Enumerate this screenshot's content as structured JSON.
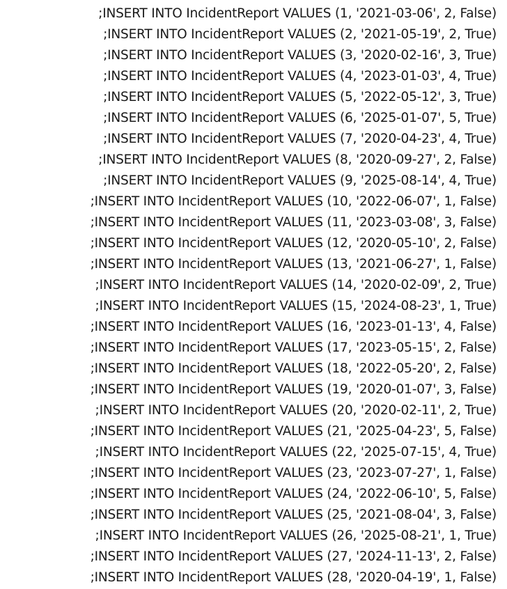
{
  "lines": [
    ";INSERT INTO IncidentReport VALUES (1, '2021-03-06', 2, False)",
    ";INSERT INTO IncidentReport VALUES (2, '2021-05-19', 2, True)",
    ";INSERT INTO IncidentReport VALUES (3, '2020-02-16', 3, True)",
    ";INSERT INTO IncidentReport VALUES (4, '2023-01-03', 4, True)",
    ";INSERT INTO IncidentReport VALUES (5, '2022-05-12', 3, True)",
    ";INSERT INTO IncidentReport VALUES (6, '2025-01-07', 5, True)",
    ";INSERT INTO IncidentReport VALUES (7, '2020-04-23', 4, True)",
    ";INSERT INTO IncidentReport VALUES (8, '2020-09-27', 2, False)",
    ";INSERT INTO IncidentReport VALUES (9, '2025-08-14', 4, True)",
    ";INSERT INTO IncidentReport VALUES (10, '2022-06-07', 1, False)",
    ";INSERT INTO IncidentReport VALUES (11, '2023-03-08', 3, False)",
    ";INSERT INTO IncidentReport VALUES (12, '2020-05-10', 2, False)",
    ";INSERT INTO IncidentReport VALUES (13, '2021-06-27', 1, False)",
    ";INSERT INTO IncidentReport VALUES (14, '2020-02-09', 2, True)",
    ";INSERT INTO IncidentReport VALUES (15, '2024-08-23', 1, True)",
    ";INSERT INTO IncidentReport VALUES (16, '2023-01-13', 4, False)",
    ";INSERT INTO IncidentReport VALUES (17, '2023-05-15', 2, False)",
    ";INSERT INTO IncidentReport VALUES (18, '2022-05-20', 2, False)",
    ";INSERT INTO IncidentReport VALUES (19, '2020-01-07', 3, False)",
    ";INSERT INTO IncidentReport VALUES (20, '2020-02-11', 2, True)",
    ";INSERT INTO IncidentReport VALUES (21, '2025-04-23', 5, False)",
    ";INSERT INTO IncidentReport VALUES (22, '2025-07-15', 4, True)",
    ";INSERT INTO IncidentReport VALUES (23, '2023-07-27', 1, False)",
    ";INSERT INTO IncidentReport VALUES (24, '2022-06-10', 5, False)",
    ";INSERT INTO IncidentReport VALUES (25, '2021-08-04', 3, False)",
    ";INSERT INTO IncidentReport VALUES (26, '2025-08-21', 1, True)",
    ";INSERT INTO IncidentReport VALUES (27, '2024-11-13', 2, False)",
    ";INSERT INTO IncidentReport VALUES (28, '2020-04-19', 1, False)"
  ]
}
